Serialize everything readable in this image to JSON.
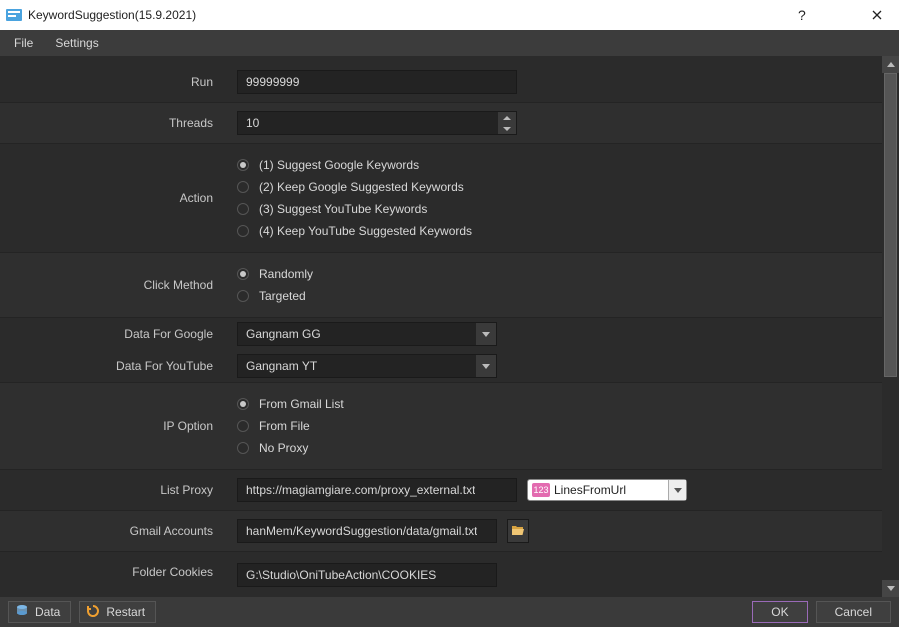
{
  "window": {
    "title": "KeywordSuggestion(15.9.2021)"
  },
  "menubar": {
    "file": "File",
    "settings": "Settings"
  },
  "labels": {
    "run": "Run",
    "threads": "Threads",
    "action": "Action",
    "click_method": "Click Method",
    "data_for_google": "Data For Google",
    "data_for_youtube": "Data For YouTube",
    "ip_option": "IP Option",
    "list_proxy": "List Proxy",
    "gmail_accounts": "Gmail Accounts",
    "folder_cookies": "Folder Cookies"
  },
  "values": {
    "run": "99999999",
    "threads": "10",
    "action_options": [
      "(1) Suggest Google Keywords",
      "(2) Keep Google Suggested Keywords",
      "(3) Suggest YouTube Keywords",
      "(4) Keep YouTube Suggested Keywords"
    ],
    "click_method_options": [
      "Randomly",
      "Targeted"
    ],
    "data_google": "Gangnam GG",
    "data_youtube": "Gangnam YT",
    "ip_options": [
      "From Gmail List",
      "From File",
      "No Proxy"
    ],
    "list_proxy": "https://magiamgiare.com/proxy_external.txt",
    "list_proxy_expr_badge": "123",
    "list_proxy_expr_text": "LinesFromUrl",
    "gmail_accounts": "hanMem/KeywordSuggestion/data/gmail.txt",
    "folder_cookies": "G:\\Studio\\OniTubeAction\\COOKIES"
  },
  "bottombar": {
    "data": "Data",
    "restart": "Restart",
    "ok": "OK",
    "cancel": "Cancel"
  }
}
